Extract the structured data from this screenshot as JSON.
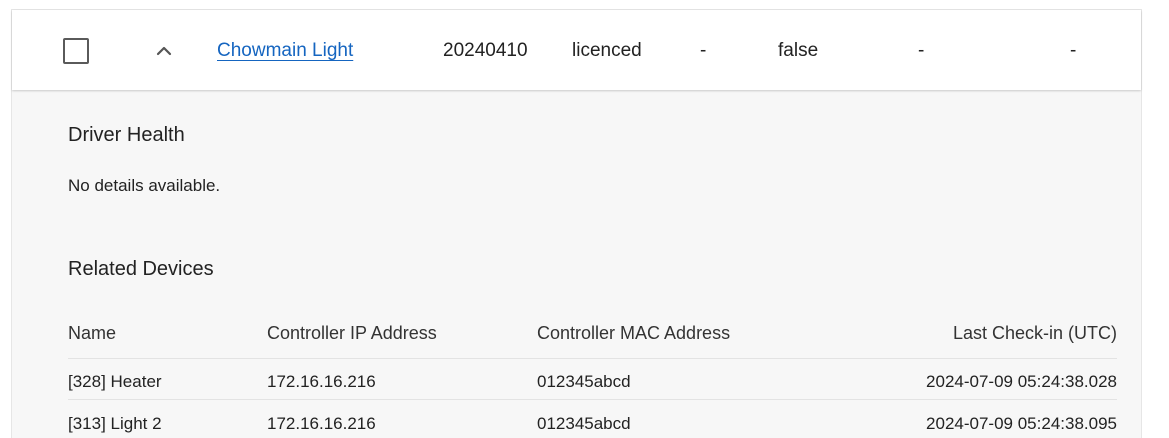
{
  "row": {
    "name": "Chowmain Light",
    "version": "20240410",
    "license": "licenced",
    "col4": "-",
    "flag": "false",
    "col6": "-",
    "col7": "-"
  },
  "details": {
    "health_heading": "Driver Health",
    "health_text": "No details available.",
    "devices_heading": "Related Devices",
    "columns": {
      "name": "Name",
      "ip": "Controller IP Address",
      "mac": "Controller MAC Address",
      "checkin": "Last Check-in (UTC)"
    },
    "devices": [
      {
        "name": "[328] Heater",
        "ip": "172.16.16.216",
        "mac": "012345abcd",
        "checkin": "2024-07-09 05:24:38.028"
      },
      {
        "name": "[313] Light 2",
        "ip": "172.16.16.216",
        "mac": "012345abcd",
        "checkin": "2024-07-09 05:24:38.095"
      }
    ]
  },
  "icons": {
    "checkbox": "checkbox-empty-icon",
    "chevron": "chevron-up-icon"
  },
  "colors": {
    "link": "#1565c0",
    "panel_bg": "#f7f7f7",
    "row_bg": "#ffffff"
  }
}
